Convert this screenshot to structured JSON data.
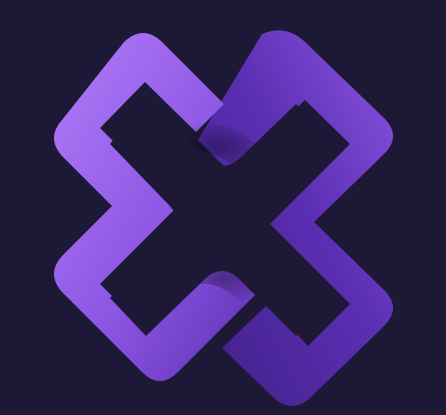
{
  "icon": {
    "name": "cross-ring-logo-icon"
  },
  "colors": {
    "background": "#1e1837",
    "logo_light": "#b27cf9",
    "logo_mid": "#8c55e3",
    "logo_dark": "#5b2fb3",
    "logo_deep": "#3f1f86"
  }
}
